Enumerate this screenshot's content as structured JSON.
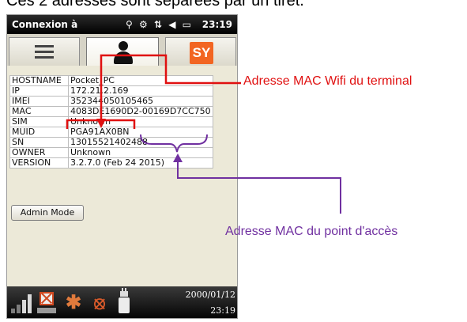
{
  "caption_top": "Ces 2 adresses sont séparées par un tiret.",
  "statusbar": {
    "title": "Connexion à",
    "clock": "23:19"
  },
  "tabs": [
    {
      "icon": "list-icon"
    },
    {
      "icon": "person-icon",
      "selected": true
    },
    {
      "icon": "sy-logo",
      "label": "SY"
    }
  ],
  "info_rows": [
    {
      "key": "HOSTNAME",
      "value": "Pocket_PC"
    },
    {
      "key": "IP",
      "value": "172.21.2.169"
    },
    {
      "key": "IMEI",
      "value": "352344050105465"
    },
    {
      "key": "MAC",
      "value": "4083DE1690D2-00169D7CC750"
    },
    {
      "key": "SIM",
      "value": "Unknown"
    },
    {
      "key": "MUID",
      "value": "PGA91AX0BN"
    },
    {
      "key": "SN",
      "value": "13015521402488"
    },
    {
      "key": "OWNER",
      "value": "Unknown"
    },
    {
      "key": "VERSION",
      "value": "3.2.7.0 (Feb 24 2015)"
    }
  ],
  "admin_button": "Admin Mode",
  "bottombar": {
    "date": "2000/01/12",
    "time": "23:19"
  },
  "annotations": {
    "mac_wifi_terminal": "Adresse MAC Wifi du terminal",
    "mac_access_point": "Adresse MAC du point d'accès",
    "red_color": "#e01010",
    "purple_color": "#7030a0"
  }
}
